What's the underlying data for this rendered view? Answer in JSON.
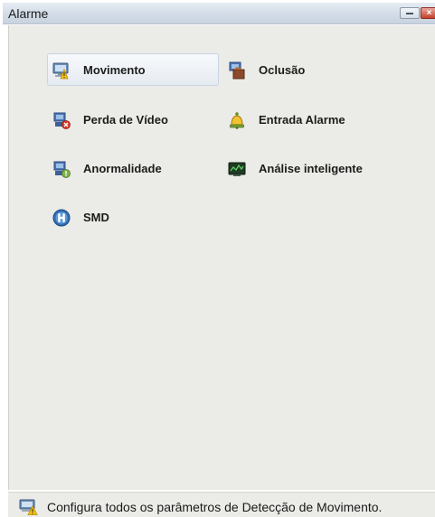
{
  "window": {
    "title": "Alarme"
  },
  "menu": {
    "items": [
      {
        "label": "Movimento",
        "icon": "motion-detection-icon",
        "selected": true
      },
      {
        "label": "Oclusão",
        "icon": "occlusion-icon",
        "selected": false
      },
      {
        "label": "Perda de Vídeo",
        "icon": "video-loss-icon",
        "selected": false
      },
      {
        "label": "Entrada Alarme",
        "icon": "alarm-input-icon",
        "selected": false
      },
      {
        "label": "Anormalidade",
        "icon": "abnormality-icon",
        "selected": false
      },
      {
        "label": "Análise inteligente",
        "icon": "intelligent-analysis-icon",
        "selected": false
      },
      {
        "label": "SMD",
        "icon": "smd-icon",
        "selected": false
      }
    ]
  },
  "status": {
    "text": "Configura todos os parâmetros de Detecção de Movimento.",
    "icon": "motion-detection-icon"
  },
  "colors": {
    "content_background": "#ebebe7",
    "selection_background": "#eef2f7",
    "close_button": "#c4402c"
  }
}
